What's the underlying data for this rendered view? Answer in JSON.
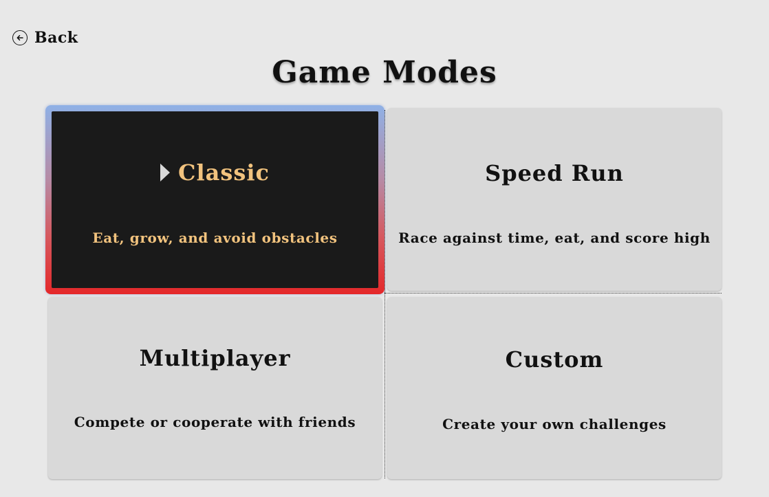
{
  "nav": {
    "back_label": "Back"
  },
  "header": {
    "title": "Game Modes"
  },
  "modes": [
    {
      "title": "Classic",
      "description": "Eat, grow, and avoid obstacles",
      "selected": true
    },
    {
      "title": "Speed Run",
      "description": "Race against time, eat, and score high",
      "selected": false
    },
    {
      "title": "Multiplayer",
      "description": "Compete or cooperate with friends",
      "selected": false
    },
    {
      "title": "Custom",
      "description": "Create your own challenges",
      "selected": false
    }
  ],
  "colors": {
    "background": "#e8e8e8",
    "card": "#d9d9d9",
    "selected_card": "#1a1a1a",
    "selected_text": "#f2c37e",
    "selected_border_top": "#8fb1e6",
    "selected_border_bottom": "#e4282a"
  },
  "icons": {
    "back": "back-arrow-circle-icon",
    "selected_marker": "caret-right-icon"
  }
}
